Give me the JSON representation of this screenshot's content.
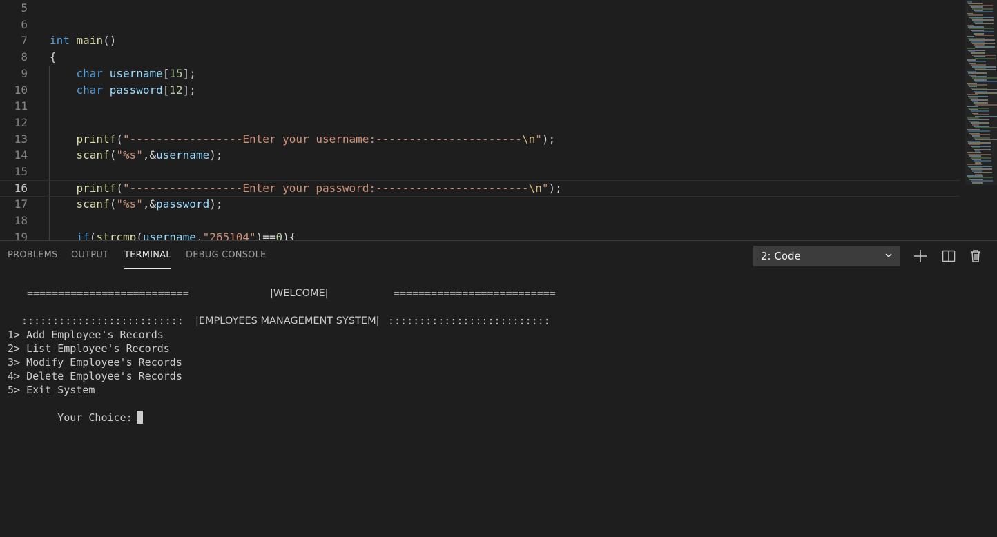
{
  "editor": {
    "lines": [
      {
        "n": "5",
        "tokens": []
      },
      {
        "n": "6",
        "tokens": []
      },
      {
        "n": "7",
        "tokens": [
          [
            "kw",
            "int"
          ],
          [
            "punc",
            " "
          ],
          [
            "fn",
            "main"
          ],
          [
            "punc",
            "()"
          ]
        ]
      },
      {
        "n": "8",
        "tokens": [
          [
            "punc",
            "{"
          ]
        ]
      },
      {
        "n": "9",
        "tokens": [
          [
            "punc",
            "    "
          ],
          [
            "kw",
            "char"
          ],
          [
            "punc",
            " "
          ],
          [
            "var",
            "username"
          ],
          [
            "punc",
            "["
          ],
          [
            "num",
            "15"
          ],
          [
            "punc",
            "];"
          ]
        ]
      },
      {
        "n": "10",
        "tokens": [
          [
            "punc",
            "    "
          ],
          [
            "kw",
            "char"
          ],
          [
            "punc",
            " "
          ],
          [
            "var",
            "password"
          ],
          [
            "punc",
            "["
          ],
          [
            "num",
            "12"
          ],
          [
            "punc",
            "];"
          ]
        ]
      },
      {
        "n": "11",
        "tokens": []
      },
      {
        "n": "12",
        "tokens": []
      },
      {
        "n": "13",
        "tokens": [
          [
            "punc",
            "    "
          ],
          [
            "fn",
            "printf"
          ],
          [
            "punc",
            "("
          ],
          [
            "str",
            "\"-----------------Enter your username:----------------------"
          ],
          [
            "esc",
            "\\n"
          ],
          [
            "str",
            "\""
          ],
          [
            "punc",
            ");"
          ]
        ]
      },
      {
        "n": "14",
        "tokens": [
          [
            "punc",
            "    "
          ],
          [
            "fn",
            "scanf"
          ],
          [
            "punc",
            "("
          ],
          [
            "str",
            "\"%s\""
          ],
          [
            "punc",
            ",&"
          ],
          [
            "var",
            "username"
          ],
          [
            "punc",
            ");"
          ]
        ]
      },
      {
        "n": "15",
        "tokens": []
      },
      {
        "n": "16",
        "tokens": [
          [
            "punc",
            "    "
          ],
          [
            "fn",
            "printf"
          ],
          [
            "punc",
            "("
          ],
          [
            "str",
            "\"-----------------Enter your password:-----------------------"
          ],
          [
            "esc",
            "\\n"
          ],
          [
            "str",
            "\""
          ],
          [
            "punc",
            ");"
          ]
        ]
      },
      {
        "n": "17",
        "tokens": [
          [
            "punc",
            "    "
          ],
          [
            "fn",
            "scanf"
          ],
          [
            "punc",
            "("
          ],
          [
            "str",
            "\"%s\""
          ],
          [
            "punc",
            ",&"
          ],
          [
            "var",
            "password"
          ],
          [
            "punc",
            ");"
          ]
        ]
      },
      {
        "n": "18",
        "tokens": []
      },
      {
        "n": "19",
        "tokens": [
          [
            "punc",
            "    "
          ],
          [
            "kw",
            "if"
          ],
          [
            "punc",
            "("
          ],
          [
            "fn",
            "strcmp"
          ],
          [
            "punc",
            "("
          ],
          [
            "var",
            "username"
          ],
          [
            "punc",
            ","
          ],
          [
            "str",
            "\"265104\""
          ],
          [
            "punc",
            ")=="
          ],
          [
            "num",
            "0"
          ],
          [
            "punc",
            "){"
          ]
        ]
      }
    ],
    "current_line": "16"
  },
  "panel": {
    "tabs": [
      {
        "label": "PROBLEMS",
        "active": false
      },
      {
        "label": "OUTPUT",
        "active": false
      },
      {
        "label": "TERMINAL",
        "active": true
      },
      {
        "label": "DEBUG CONSOLE",
        "active": false
      }
    ],
    "terminal_select": "2: Code",
    "icons": [
      "plus-icon",
      "split-icon",
      "trash-icon"
    ]
  },
  "terminal": {
    "welcome_left": "==========================",
    "welcome_title": "|WELCOME|",
    "welcome_right": "==========================",
    "system_left": "::::::::::::::::::::::::::",
    "system_title": "|EMPLOYEES MANAGEMENT SYSTEM|",
    "system_right": "::::::::::::::::::::::::::",
    "menu": [
      "1> Add Employee's Records",
      "2> List Employee's Records",
      "3> Modify Employee's Records",
      "4> Delete Employee's Records",
      "5> Exit System"
    ],
    "prompt": "Your Choice:"
  },
  "colors": {
    "background": "#1e1e1e",
    "keyword": "#569cd6",
    "function": "#dcdcaa",
    "variable": "#9cdcfe",
    "number": "#b5cea8",
    "string": "#ce9178",
    "escape": "#d7ba7d",
    "terminal_text": "#cccccc"
  }
}
